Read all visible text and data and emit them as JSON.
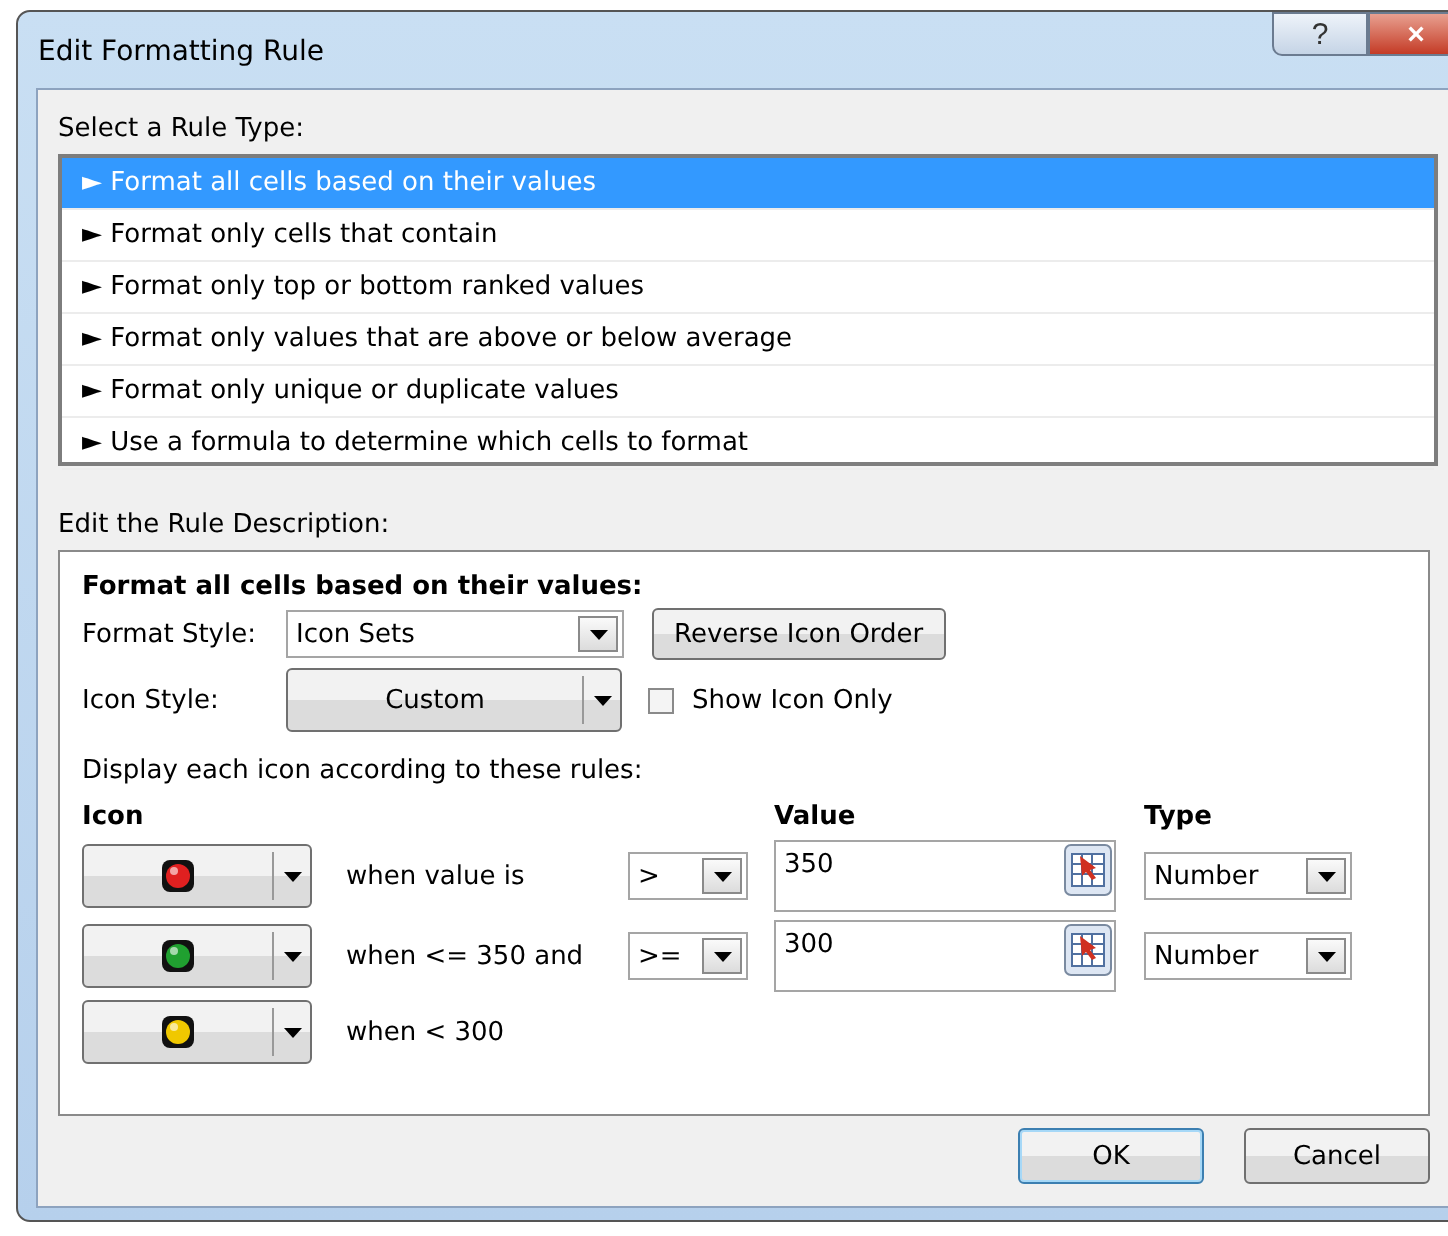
{
  "window": {
    "title": "Edit Formatting Rule",
    "controls": [
      "?",
      "×"
    ]
  },
  "rule_type": {
    "label": "Select a Rule Type:",
    "items": [
      {
        "label": "► Format all cells based on their values",
        "selected": true
      },
      {
        "label": "► Format only cells that contain",
        "selected": false
      },
      {
        "label": "► Format only top or bottom ranked values",
        "selected": false
      },
      {
        "label": "► Format only values that are above or below average",
        "selected": false
      },
      {
        "label": "► Format only unique or duplicate values",
        "selected": false
      },
      {
        "label": "► Use a formula to determine which cells to format",
        "selected": false
      }
    ]
  },
  "description": {
    "label": "Edit the Rule Description:",
    "heading": "Format all cells based on their values:",
    "format_style": {
      "label": "Format Style:",
      "value": "Icon Sets"
    },
    "reverse_button": "Reverse Icon Order",
    "icon_style": {
      "label": "Icon Style:",
      "value": "Custom"
    },
    "show_icon_only": {
      "label": "Show Icon Only",
      "checked": false
    },
    "rules_label": "Display each icon according to these rules:",
    "columns": {
      "icon": "Icon",
      "value": "Value",
      "type": "Type"
    },
    "rules": [
      {
        "color": "#e02020",
        "condition": "when value is",
        "operator": ">",
        "value": "350",
        "type": "Number"
      },
      {
        "color": "#20a030",
        "condition": "when <= 350 and",
        "operator": ">=",
        "value": "300",
        "type": "Number"
      },
      {
        "color": "#f0c800",
        "condition": "when < 300"
      }
    ]
  },
  "buttons": [
    "OK",
    "Cancel"
  ]
}
